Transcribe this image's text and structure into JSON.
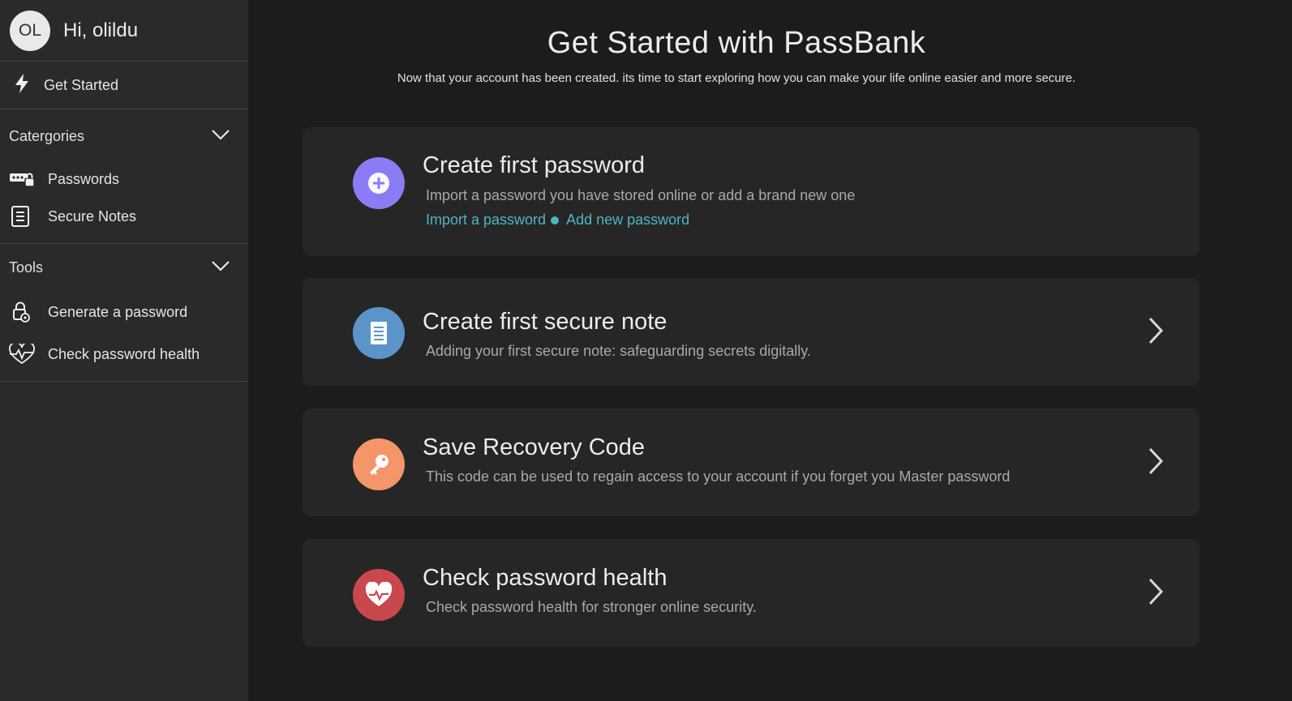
{
  "sidebar": {
    "avatar_initials": "OL",
    "greeting": "Hi, olildu",
    "get_started": "Get Started",
    "categories": {
      "label": "Catergories",
      "items": [
        {
          "label": "Passwords",
          "icon": "password-key-icon"
        },
        {
          "label": "Secure Notes",
          "icon": "note-icon"
        }
      ]
    },
    "tools": {
      "label": "Tools",
      "items": [
        {
          "label": "Generate a password",
          "icon": "generate-lock-icon"
        },
        {
          "label": "Check password health",
          "icon": "heartbeat-icon"
        }
      ]
    }
  },
  "main": {
    "title": "Get Started with PassBank",
    "subtitle": "Now that your account has been created. its time to start exploring how you can make your life online easier and more secure.",
    "cards": [
      {
        "title": "Create first password",
        "description": "Import a password you have stored online or add a brand new one",
        "link_import": "Import a password",
        "link_add": "Add new password",
        "icon": "plus-icon",
        "color": "#8b7cf6"
      },
      {
        "title": "Create first secure note",
        "description": "Adding your first secure note: safeguarding secrets digitally.",
        "icon": "note-icon",
        "color": "#5b94c8"
      },
      {
        "title": "Save Recovery Code",
        "description": "This code can be used to regain access to your account if you forget you Master password",
        "icon": "key-icon",
        "color": "#f4956a"
      },
      {
        "title": "Check password health",
        "description": "Check password health for stronger online security.",
        "icon": "heart-pulse-icon",
        "color": "#c9484e"
      }
    ],
    "accent_link_color": "#4db6c1"
  }
}
